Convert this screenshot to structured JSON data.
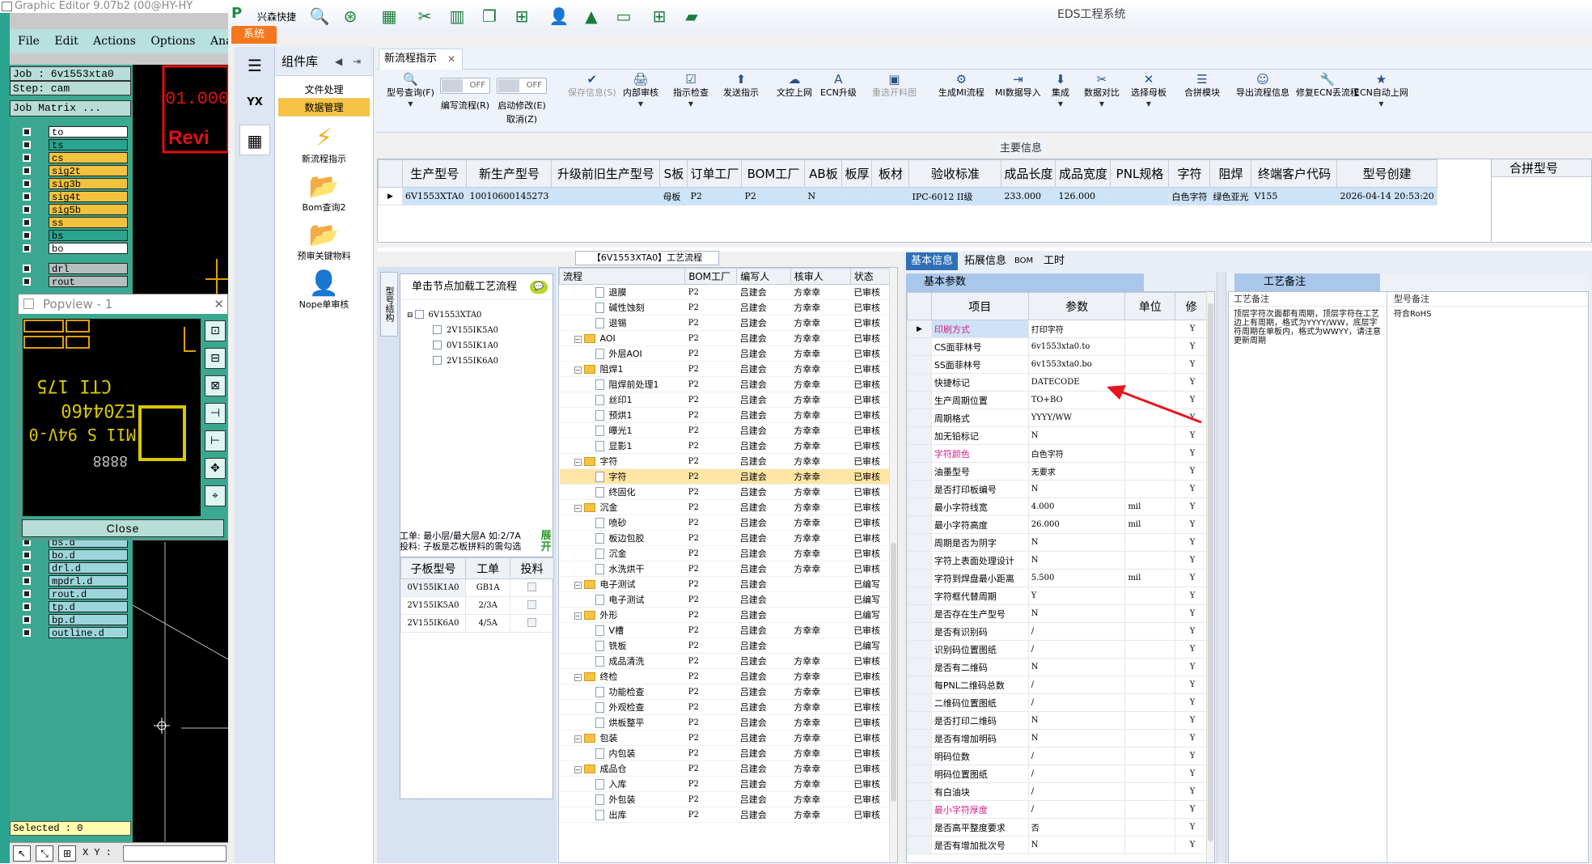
{
  "graphic_editor": {
    "title": "Graphic Editor 9.07b2 (00@HY-HY",
    "menu": [
      "File",
      "Edit",
      "Actions",
      "Options",
      "Analysi"
    ],
    "job_label": "Job : 6v1553xta0",
    "step_label": "Step: cam",
    "job_matrix": "Job Matrix ...",
    "layers_top": [
      "to",
      "ts",
      "cs",
      "sig2t",
      "sig3b",
      "sig4t",
      "sig5b",
      "ss",
      "bs",
      "bo"
    ],
    "layers_mid": [
      "drl",
      "rout"
    ],
    "layers_bottom": [
      "bs.d",
      "bo.d",
      "drl.d",
      "mpdrl.d",
      "rout.d",
      "tp.d",
      "bp.d",
      "outline.d"
    ],
    "canvas_text": [
      "01.000",
      "Revi"
    ],
    "selected": "Selected : 0",
    "xy_label": "X Y :",
    "popview": {
      "title": "Popview - 1",
      "close": "Close",
      "image_text": [
        "CTI 175",
        "EZ04460",
        "M11 S 94V-0",
        "8888"
      ]
    }
  },
  "eds": {
    "title": "EDS工程系统",
    "brand": "兴森快捷",
    "system_tab": "系统",
    "side_label": "YX",
    "component_lib": {
      "title": "组件库",
      "groups": [
        "文件处理",
        "数据管理"
      ],
      "items": [
        "新流程指示",
        "Bom查询2",
        "预审关键物料",
        "Nope单审核"
      ]
    },
    "tab": "新流程指示",
    "toolbar": [
      {
        "icon": "🔍",
        "label": "型号查询(F)",
        "dd": true
      },
      {
        "icon": "",
        "label": "编写流程(R)",
        "toggle": "OFF"
      },
      {
        "icon": "",
        "label": "启动修改(E)",
        "toggle": "OFF",
        "sub": "取消(Z)"
      },
      {
        "icon": "✔",
        "label": "保存信息(S)",
        "disabled": true
      },
      {
        "icon": "🖨",
        "label": "内部审核",
        "dd": true
      },
      {
        "icon": "☑",
        "label": "指示检查",
        "dd": true
      },
      {
        "icon": "⬆",
        "label": "发送指示"
      },
      {
        "icon": "☁",
        "label": "文控上网"
      },
      {
        "icon": "A",
        "label": "ECN升级"
      },
      {
        "icon": "▣",
        "label": "重选开料图",
        "disabled": true
      },
      {
        "icon": "⚙",
        "label": "生成MI流程"
      },
      {
        "icon": "⇥",
        "label": "MI数据导入"
      },
      {
        "icon": "⬇",
        "label": "集成",
        "dd": true
      },
      {
        "icon": "✂",
        "label": "数据对比",
        "dd": true
      },
      {
        "icon": "✕",
        "label": "选择母板",
        "dd": true
      },
      {
        "icon": "☰",
        "label": "合拼模块"
      },
      {
        "icon": "☺",
        "label": "导出流程信息"
      },
      {
        "icon": "🔧",
        "label": "修复ECN丢流程"
      },
      {
        "icon": "★",
        "label": "ECN自动上网",
        "dd": true
      }
    ],
    "main_info_label": "主要信息",
    "main_grid": {
      "headers": [
        "生产型号",
        "新生产型号",
        "升级前旧生产型号",
        "S板",
        "订单工厂",
        "BOM工厂",
        "AB板",
        "板厚",
        "板材",
        "验收标准",
        "成品长度",
        "成品宽度",
        "PNL规格",
        "字符",
        "阻焊",
        "终端客户代码",
        "型号创建"
      ],
      "row": [
        "6V1553XTA0",
        "10010600145273",
        "",
        "母板",
        "P2",
        "P2",
        "N",
        "",
        "",
        "IPC-6012 II级",
        "233.000",
        "126.000",
        "",
        "白色字符",
        "绿色亚光",
        "V155",
        "2026-04-14 20:53:20"
      ],
      "merge_header": "合拼型号"
    },
    "process_caption": "【6V1553XTA0】工艺流程",
    "tree": {
      "side_tab": "型号结构",
      "hint": "单击节点加载工艺流程",
      "nodes": [
        "6V1553XTA0",
        "2V155IK5A0",
        "0V155IK1A0",
        "2V155IK6A0"
      ],
      "info_line1": "工单: 最小层/最大层A 如:2/7A",
      "info_line2": "投料: 子板是芯板拼料的需勾选",
      "expand": "展开",
      "sub_headers": [
        "子板型号",
        "工单",
        "投料"
      ],
      "sub_rows": [
        [
          "0V155IK1A0",
          "GB1A"
        ],
        [
          "2V155IK5A0",
          "2/3A"
        ],
        [
          "2V155IK6A0",
          "4/5A"
        ]
      ]
    },
    "flow": {
      "headers": [
        "流程",
        "BOM工厂",
        "编写人",
        "核审人",
        "状态"
      ],
      "rows": [
        {
          "lvl": 2,
          "name": "退膜",
          "bom": "P2",
          "w": "吕建会",
          "r": "方幸幸",
          "s": "已审核"
        },
        {
          "lvl": 2,
          "name": "碱性蚀刻",
          "bom": "P2",
          "w": "吕建会",
          "r": "方幸幸",
          "s": "已审核"
        },
        {
          "lvl": 2,
          "name": "退锡",
          "bom": "P2",
          "w": "吕建会",
          "r": "方幸幸",
          "s": "已审核"
        },
        {
          "lvl": 1,
          "name": "AOI",
          "bom": "P2",
          "w": "吕建会",
          "r": "方幸幸",
          "s": "已审核"
        },
        {
          "lvl": 2,
          "name": "外层AOI",
          "bom": "P2",
          "w": "吕建会",
          "r": "方幸幸",
          "s": "已审核"
        },
        {
          "lvl": 1,
          "name": "阻焊1",
          "bom": "P2",
          "w": "吕建会",
          "r": "方幸幸",
          "s": "已审核"
        },
        {
          "lvl": 2,
          "name": "阻焊前处理1",
          "bom": "P2",
          "w": "吕建会",
          "r": "方幸幸",
          "s": "已审核"
        },
        {
          "lvl": 2,
          "name": "丝印1",
          "bom": "P2",
          "w": "吕建会",
          "r": "方幸幸",
          "s": "已审核"
        },
        {
          "lvl": 2,
          "name": "预烘1",
          "bom": "P2",
          "w": "吕建会",
          "r": "方幸幸",
          "s": "已审核"
        },
        {
          "lvl": 2,
          "name": "曝光1",
          "bom": "P2",
          "w": "吕建会",
          "r": "方幸幸",
          "s": "已审核"
        },
        {
          "lvl": 2,
          "name": "显影1",
          "bom": "P2",
          "w": "吕建会",
          "r": "方幸幸",
          "s": "已审核"
        },
        {
          "lvl": 1,
          "name": "字符",
          "bom": "P2",
          "w": "吕建会",
          "r": "方幸幸",
          "s": "已审核"
        },
        {
          "lvl": 2,
          "name": "字符",
          "bom": "P2",
          "w": "吕建会",
          "r": "方幸幸",
          "s": "已审核",
          "sel": true
        },
        {
          "lvl": 2,
          "name": "终固化",
          "bom": "P2",
          "w": "吕建会",
          "r": "方幸幸",
          "s": "已审核"
        },
        {
          "lvl": 1,
          "name": "沉金",
          "bom": "P2",
          "w": "吕建会",
          "r": "方幸幸",
          "s": "已审核"
        },
        {
          "lvl": 2,
          "name": "喷砂",
          "bom": "P2",
          "w": "吕建会",
          "r": "方幸幸",
          "s": "已审核"
        },
        {
          "lvl": 2,
          "name": "板边包胶",
          "bom": "P2",
          "w": "吕建会",
          "r": "方幸幸",
          "s": "已审核"
        },
        {
          "lvl": 2,
          "name": "沉金",
          "bom": "P2",
          "w": "吕建会",
          "r": "方幸幸",
          "s": "已审核"
        },
        {
          "lvl": 2,
          "name": "水洗烘干",
          "bom": "P2",
          "w": "吕建会",
          "r": "方幸幸",
          "s": "已审核"
        },
        {
          "lvl": 1,
          "name": "电子测试",
          "bom": "P2",
          "w": "吕建会",
          "r": "",
          "s": "已编写"
        },
        {
          "lvl": 2,
          "name": "电子测试",
          "bom": "P2",
          "w": "吕建会",
          "r": "",
          "s": "已编写"
        },
        {
          "lvl": 1,
          "name": "外形",
          "bom": "P2",
          "w": "吕建会",
          "r": "",
          "s": "已编写"
        },
        {
          "lvl": 2,
          "name": "V槽",
          "bom": "P2",
          "w": "吕建会",
          "r": "方幸幸",
          "s": "已审核"
        },
        {
          "lvl": 2,
          "name": "铣板",
          "bom": "P2",
          "w": "吕建会",
          "r": "",
          "s": "已编写"
        },
        {
          "lvl": 2,
          "name": "成品清洗",
          "bom": "P2",
          "w": "吕建会",
          "r": "方幸幸",
          "s": "已审核"
        },
        {
          "lvl": 1,
          "name": "终检",
          "bom": "P2",
          "w": "吕建会",
          "r": "方幸幸",
          "s": "已审核"
        },
        {
          "lvl": 2,
          "name": "功能检查",
          "bom": "P2",
          "w": "吕建会",
          "r": "方幸幸",
          "s": "已审核"
        },
        {
          "lvl": 2,
          "name": "外观检查",
          "bom": "P2",
          "w": "吕建会",
          "r": "方幸幸",
          "s": "已审核"
        },
        {
          "lvl": 2,
          "name": "烘板整平",
          "bom": "P2",
          "w": "吕建会",
          "r": "方幸幸",
          "s": "已审核"
        },
        {
          "lvl": 1,
          "name": "包装",
          "bom": "P2",
          "w": "吕建会",
          "r": "方幸幸",
          "s": "已审核"
        },
        {
          "lvl": 2,
          "name": "内包装",
          "bom": "P2",
          "w": "吕建会",
          "r": "方幸幸",
          "s": "已审核"
        },
        {
          "lvl": 1,
          "name": "成品仓",
          "bom": "P2",
          "w": "吕建会",
          "r": "方幸幸",
          "s": "已审核"
        },
        {
          "lvl": 2,
          "name": "入库",
          "bom": "P2",
          "w": "吕建会",
          "r": "方幸幸",
          "s": "已审核"
        },
        {
          "lvl": 2,
          "name": "外包装",
          "bom": "P2",
          "w": "吕建会",
          "r": "方幸幸",
          "s": "已审核"
        },
        {
          "lvl": 2,
          "name": "出库",
          "bom": "P2",
          "w": "吕建会",
          "r": "方幸幸",
          "s": "已审核"
        }
      ]
    },
    "right_tabs": [
      "基本信息",
      "拓展信息",
      "BOM",
      "工时"
    ],
    "basic_params_title": "基本参数",
    "param_headers": [
      "项目",
      "参数",
      "单位",
      "修"
    ],
    "params": [
      {
        "item": "印刷方式",
        "val": "打印字符",
        "unit": "",
        "m": "Y",
        "pink": true
      },
      {
        "item": "CS面菲林号",
        "val": "6v1553xta0.to",
        "unit": "",
        "m": "Y"
      },
      {
        "item": "SS面菲林号",
        "val": "6v1553xta0.bo",
        "unit": "",
        "m": "Y"
      },
      {
        "item": "快捷标记",
        "val": "DATECODE",
        "unit": "",
        "m": "Y"
      },
      {
        "item": "生产周期位置",
        "val": "TO+BO",
        "unit": "",
        "m": "Y"
      },
      {
        "item": "周期格式",
        "val": "YYYY/WW",
        "unit": "",
        "m": "Y"
      },
      {
        "item": "加无铅标记",
        "val": "N",
        "unit": "",
        "m": "Y"
      },
      {
        "item": "字符颜色",
        "val": "白色字符",
        "unit": "",
        "m": "Y",
        "pink": true
      },
      {
        "item": "油墨型号",
        "val": "无要求",
        "unit": "",
        "m": "Y"
      },
      {
        "item": "是否打印板编号",
        "val": "N",
        "unit": "",
        "m": "Y"
      },
      {
        "item": "最小字符线宽",
        "val": "4.000",
        "unit": "mil",
        "m": "Y"
      },
      {
        "item": "最小字符高度",
        "val": "26.000",
        "unit": "mil",
        "m": "Y"
      },
      {
        "item": "周期是否为阴字",
        "val": "N",
        "unit": "",
        "m": "Y"
      },
      {
        "item": "字符上表面处理设计",
        "val": "N",
        "unit": "",
        "m": "Y"
      },
      {
        "item": "字符到焊盘最小距离",
        "val": "5.500",
        "unit": "mil",
        "m": "Y"
      },
      {
        "item": "字符框代替周期",
        "val": "Y",
        "unit": "",
        "m": "Y"
      },
      {
        "item": "是否存在生产型号",
        "val": "N",
        "unit": "",
        "m": "Y"
      },
      {
        "item": "是否有识别码",
        "val": "/",
        "unit": "",
        "m": "Y"
      },
      {
        "item": "识别码位置图纸",
        "val": "/",
        "unit": "",
        "m": "Y"
      },
      {
        "item": "是否有二维码",
        "val": "N",
        "unit": "",
        "m": "Y"
      },
      {
        "item": "每PNL二维码总数",
        "val": "/",
        "unit": "",
        "m": "Y"
      },
      {
        "item": "二维码位置图纸",
        "val": "/",
        "unit": "",
        "m": "Y"
      },
      {
        "item": "是否打印二维码",
        "val": "N",
        "unit": "",
        "m": "Y"
      },
      {
        "item": "是否有增加明码",
        "val": "N",
        "unit": "",
        "m": "Y"
      },
      {
        "item": "明码位数",
        "val": "/",
        "unit": "",
        "m": "Y"
      },
      {
        "item": "明码位置图纸",
        "val": "/",
        "unit": "",
        "m": "Y"
      },
      {
        "item": "有白油块",
        "val": "/",
        "unit": "",
        "m": "Y"
      },
      {
        "item": "最小字符厚度",
        "val": "/",
        "unit": "",
        "m": "Y",
        "pink": true
      },
      {
        "item": "是否高平整度要求",
        "val": "否",
        "unit": "",
        "m": "Y"
      },
      {
        "item": "是否有增加批次号",
        "val": "N",
        "unit": "",
        "m": "Y"
      }
    ],
    "notes": {
      "title": "工艺备注",
      "col1": "工艺备注",
      "col2": "型号备注",
      "process_note": "顶层字符次面都有周期，顶层字符在工艺边上有周期，格式为YYYY/WW，底层字符周期在单板内，格式为WWYY，请注意更新周期",
      "model_note": "符合RoHS"
    },
    "colors": {
      "accent": "#2f6fb8",
      "selected_row": "#ffe6a6",
      "pink": "#d4208a",
      "arrow": "#e8141c"
    }
  }
}
